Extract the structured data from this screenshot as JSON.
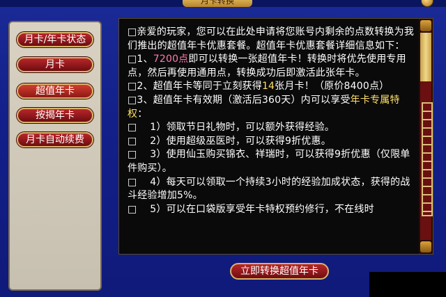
{
  "window": {
    "title": "月卡转换"
  },
  "sidebar": {
    "items": [
      {
        "label": "月卡/年卡状态"
      },
      {
        "label": "月卡"
      },
      {
        "label": "超值年卡"
      },
      {
        "label": "按揭年卡"
      },
      {
        "label": "月卡自动续费"
      }
    ]
  },
  "content": {
    "intro_a": "□亲爱的玩家，您可以在此处申请将您账号内剩余的点数转换为我们推出的超值年卡优惠套餐。超值年卡优惠套餐详细信息如下：",
    "p1_pre": "□1、",
    "p1_hl": "7200点",
    "p1_post": "即可以转换一张超值年卡！转换时将优先使用专用点，然后再使用通用点，转换成功后即激活此张年卡。",
    "p2_pre": "□2、超值年卡等同于立刻获得",
    "p2_hl": "14",
    "p2_post": "张月卡！（原价8400点）",
    "p3_pre": "□3、超值年卡有效期（激活后360天）内可以享受",
    "p3_hl": "年卡专属特权",
    "p3_post": "：",
    "b1": "□　 1）领取节日礼物时，可以额外获得经验。",
    "b2": "□　 2）使用超级巫医时，可以获得9折优惠。",
    "b3": "□　 3）使用仙玉购买锦衣、祥瑞时，可以获得9折优惠（仅限单件购买）。",
    "b4": "□　 4）每天可以领取一个持续3小时的经验加成状态，获得的战斗经验增加5%。",
    "b5": "□　 5）可以在口袋版享受年卡特权预约修行，不在线时"
  },
  "actions": {
    "convert_label": "立即转换超值年卡"
  },
  "colors": {
    "highlight_pink": "#ff7ab0",
    "highlight_yellow": "#ffe066",
    "button_red": "#b8262a"
  }
}
